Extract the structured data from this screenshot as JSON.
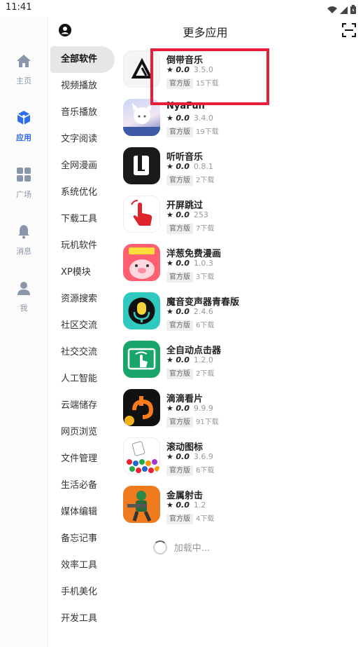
{
  "status": {
    "time": "11:41",
    "icons": [
      "wifi-icon",
      "signal-icon",
      "battery-icon"
    ]
  },
  "rail": [
    {
      "label": "主页",
      "icon": "home-icon",
      "active": false
    },
    {
      "label": "应用",
      "icon": "apps-cube-icon",
      "active": true
    },
    {
      "label": "广场",
      "icon": "grid-icon",
      "active": false
    },
    {
      "label": "消息",
      "icon": "bell-icon",
      "active": false
    },
    {
      "label": "我",
      "icon": "user-icon",
      "active": false
    }
  ],
  "header": {
    "title": "更多应用",
    "left_icon": "account-icon",
    "right_icon": "scan-icon"
  },
  "categories": [
    "全部软件",
    "视频播放",
    "音乐播放",
    "文字阅读",
    "全网漫画",
    "系统优化",
    "下载工具",
    "玩机软件",
    "XP模块",
    "资源搜索",
    "社区交流",
    "社交交流",
    "人工智能",
    "云端储存",
    "网页浏览",
    "文件管理",
    "生活必备",
    "媒体编辑",
    "备忘记事",
    "效率工具",
    "手机美化",
    "开发工具"
  ],
  "active_category": "全部软件",
  "apps": [
    {
      "name": "倒带音乐",
      "score": "0.0",
      "version": "3.5.0",
      "tag": "官方版",
      "downloads": "15下载",
      "icon": "rewind-triangle-icon"
    },
    {
      "name": "NyaFun",
      "score": "0.0",
      "version": "3.4.0",
      "tag": "官方版",
      "downloads": "19下载",
      "icon": "anime-girl-icon"
    },
    {
      "name": "听听音乐",
      "score": "0.0",
      "version": "0.8.1",
      "tag": "官方版",
      "downloads": "2下载",
      "icon": "l-logo-icon"
    },
    {
      "name": "开屏跳过",
      "score": "0.0",
      "version": "253",
      "tag": "官方版",
      "downloads": "7下载",
      "icon": "tap-hand-icon"
    },
    {
      "name": "洋葱免费漫画",
      "score": "0.0",
      "version": "1.0.3",
      "tag": "官方版",
      "downloads": "3下载",
      "icon": "onion-pig-icon"
    },
    {
      "name": "魔音变声器青春版",
      "score": "0.0",
      "version": "2.4.6",
      "tag": "官方版",
      "downloads": "6下载",
      "icon": "microphone-icon"
    },
    {
      "name": "全自动点击器",
      "score": "0.0",
      "version": "1.2.0",
      "tag": "官方版",
      "downloads": "2下载",
      "icon": "auto-click-icon"
    },
    {
      "name": "滴滴看片",
      "score": "0.0",
      "version": "9.9.9",
      "tag": "官方版",
      "downloads": "91下载",
      "icon": "didi-logo-icon"
    },
    {
      "name": "滚动图标",
      "score": "0.0",
      "version": "3.6.9",
      "tag": "官方版",
      "downloads": "6下载",
      "icon": "bubble-game-icon"
    },
    {
      "name": "金属射击",
      "score": "0.0",
      "version": "1.2",
      "tag": "官方版",
      "downloads": "4下载",
      "icon": "shooter-game-icon"
    }
  ],
  "loading_text": "加载中...",
  "colors": {
    "accent": "#2f6cf0",
    "highlight_box": "#e61e3a",
    "rail_inactive": "#8a96aa"
  }
}
